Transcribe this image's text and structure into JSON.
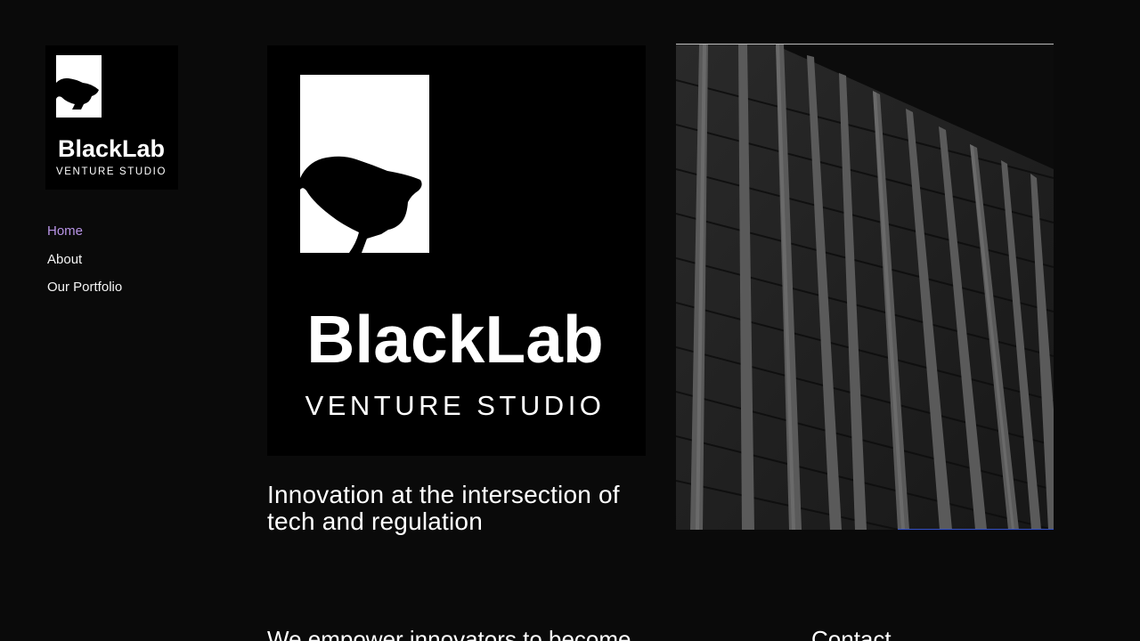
{
  "brand": {
    "name": "BlackLab",
    "subtitle": "VENTURE STUDIO"
  },
  "nav": {
    "items": [
      {
        "label": "Home",
        "active": true
      },
      {
        "label": "About",
        "active": false
      },
      {
        "label": "Our Portfolio",
        "active": false
      }
    ]
  },
  "hero": {
    "headline": "Innovation at the intersection of tech and regulation"
  },
  "lower": {
    "tagline": "We empower innovators to become",
    "contact_heading": "Contact"
  },
  "colors": {
    "background": "#0a0a0a",
    "nav_active": "#b894e6",
    "text": "#ffffff",
    "accent_line": "#3552c8"
  }
}
